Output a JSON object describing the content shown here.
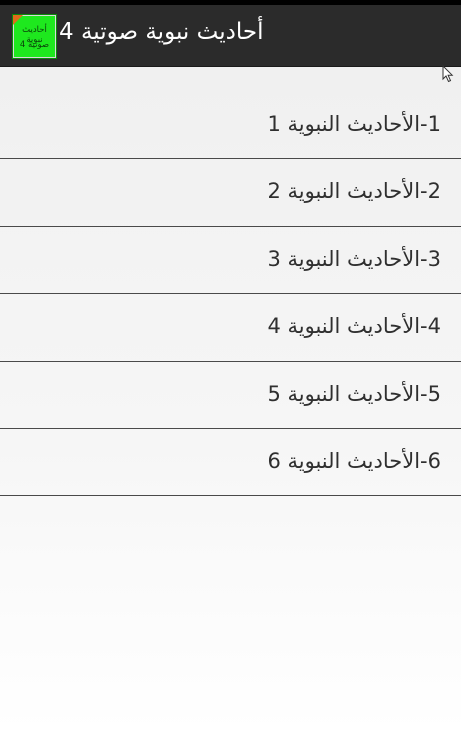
{
  "app": {
    "title": "أحاديث نبوية صوتية 4",
    "icon_text_top": "أحاديث نبوية",
    "icon_text_bottom": "صوتية 4"
  },
  "colors": {
    "action_bar": "#2b2b2b",
    "icon_background": "#1ee81e",
    "list_text": "#2f2f2f",
    "divider": "#4a4a4a"
  },
  "list": {
    "items": [
      {
        "label": "1-الأحاديث النبوية  1"
      },
      {
        "label": "2-الأحاديث النبوية  2"
      },
      {
        "label": "3-الأحاديث النبوية  3"
      },
      {
        "label": "4-الأحاديث النبوية  4"
      },
      {
        "label": "5-الأحاديث النبوية  5"
      },
      {
        "label": "6-الأحاديث النبوية  6"
      }
    ]
  }
}
